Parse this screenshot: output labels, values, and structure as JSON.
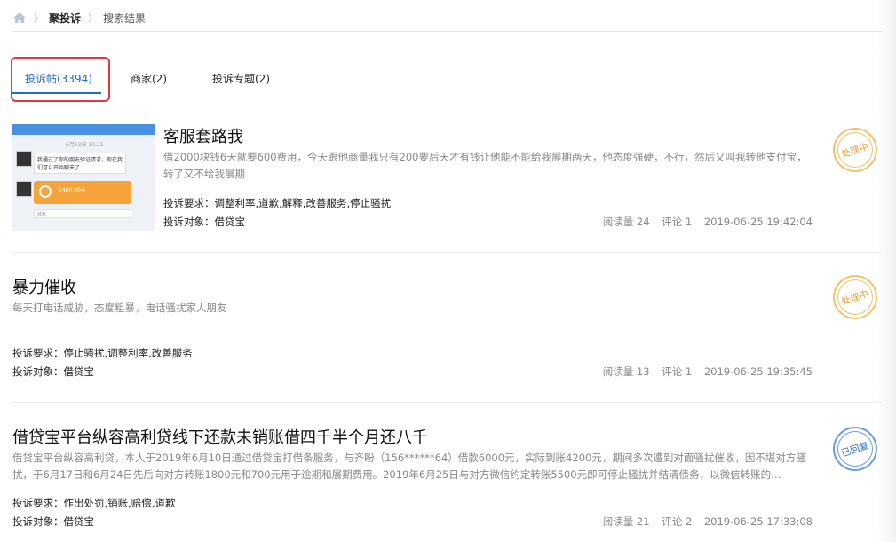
{
  "breadcrumb": {
    "level1": "聚投诉",
    "level2": "搜索结果"
  },
  "tabs": [
    {
      "label": "投诉帖(3394)",
      "active": true
    },
    {
      "label": "商家(2)",
      "active": false
    },
    {
      "label": "投诉专题(2)",
      "active": false
    }
  ],
  "colors": {
    "accent": "#1f6dd0",
    "highlight": "#e0393e",
    "status_processing": "#e9a233",
    "status_replied": "#2f6fd0"
  },
  "items": [
    {
      "title": "客服套路我",
      "desc": "借2000块钱6天就要600费用，今天跟他商量我只有200要后天才有钱让他能不能给我展期两天，他态度强硬，不行，然后又叫我转他支付宝，转了又不给我展期",
      "demand": "投诉要求：调整利率,道歉,解释,改善服务,停止骚扰",
      "target": "投诉对象：借贷宝",
      "views": "阅读量 24",
      "comments": "评论 1",
      "time": "2019-06-25 19:42:04",
      "status": "处理中",
      "thumbnail": {
        "date": "6月13日 11:21",
        "bubble": "我通过了你的朋友验证请求，现在我们可以开始聊天了",
        "amount": "1400.00元",
        "input": "转账"
      }
    },
    {
      "title": "暴力催收",
      "desc": "每天打电话威胁，态度粗暴，电话骚扰家人朋友",
      "demand": "投诉要求：停止骚扰,调整利率,改善服务",
      "target": "投诉对象：借贷宝",
      "views": "阅读量 13",
      "comments": "评论 1",
      "time": "2019-06-25 19:35:45",
      "status": "处理中"
    },
    {
      "title": "借贷宝平台纵容高利贷线下还款未销账借四千半个月还八千",
      "desc": "借贷宝平台纵容高利贷，本人于2019年6月10日通过借贷宝打借条服务，与齐盼（156******64）借款6000元，实际到账4200元，期间多次遭到对面骚扰催收，因不堪对方骚扰，于6月17日和6月24日先后向对方转账1800元和700元用于逾期和展期费用。2019年6月25日与对方微信约定转账5500元即可停止骚扰并结清债务，以微信转账的…",
      "demand": "投诉要求：作出处罚,销账,赔偿,道歉",
      "target": "投诉对象：借贷宝",
      "views": "阅读量 21",
      "comments": "评论 2",
      "time": "2019-06-25 17:33:08",
      "status": "已回复"
    }
  ]
}
